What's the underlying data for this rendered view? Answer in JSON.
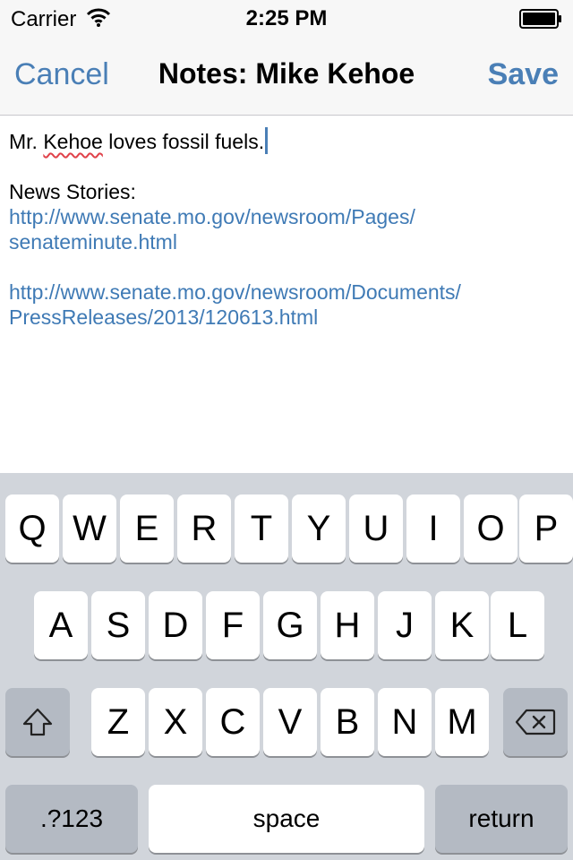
{
  "status_bar": {
    "carrier": "Carrier",
    "time": "2:25 PM",
    "wifi_icon": "wifi-icon",
    "battery_icon": "battery-icon"
  },
  "nav_bar": {
    "cancel_label": "Cancel",
    "title": "Notes: Mike Kehoe",
    "save_label": "Save"
  },
  "note": {
    "line1_prefix": "Mr. ",
    "line1_misspelled": "Kehoe",
    "line1_suffix": " loves fossil fuels.",
    "news_heading": "News Stories:",
    "link1_line1": "http://www.senate.mo.gov/newsroom/Pages/",
    "link1_line2": "senateminute.html",
    "link2_line1": "http://www.senate.mo.gov/newsroom/Documents/",
    "link2_line2": "PressReleases/2013/120613.html"
  },
  "keyboard": {
    "row1": [
      "Q",
      "W",
      "E",
      "R",
      "T",
      "Y",
      "U",
      "I",
      "O",
      "P"
    ],
    "row2": [
      "A",
      "S",
      "D",
      "F",
      "G",
      "H",
      "J",
      "K",
      "L"
    ],
    "row3": [
      "Z",
      "X",
      "C",
      "V",
      "B",
      "N",
      "M"
    ],
    "shift_icon": "shift-icon",
    "delete_icon": "delete-icon",
    "numbers_label": ".?123",
    "space_label": "space",
    "return_label": "return"
  },
  "colors": {
    "accent": "#4a7fb6",
    "link": "#3f7ab5",
    "keyboard_bg": "#d1d5db",
    "func_key": "#b4bac3"
  }
}
